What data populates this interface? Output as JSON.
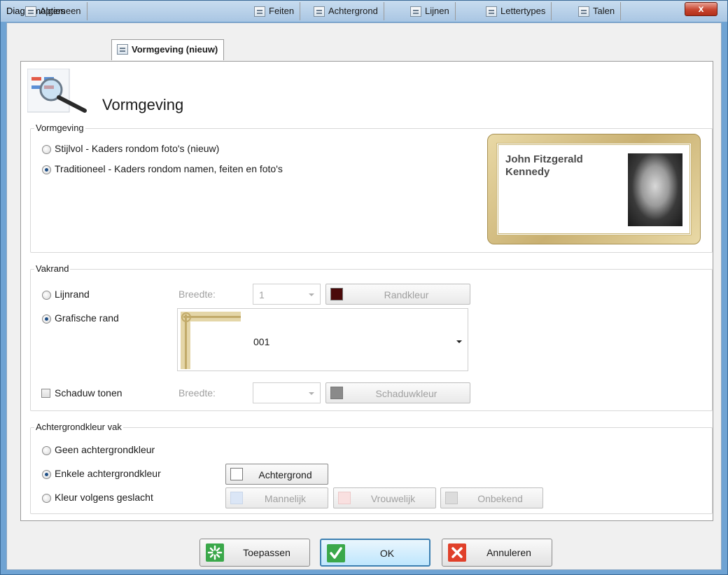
{
  "window": {
    "title": "Diagramopties",
    "close_label": "x"
  },
  "tabs": [
    {
      "label": "Algemeen",
      "icon": "settings-icon"
    },
    {
      "label": "Vormgeving (nieuw)",
      "icon": "magnifier-icon",
      "active": true
    },
    {
      "label": "Feiten",
      "icon": "facts-icon"
    },
    {
      "label": "Achtergrond",
      "icon": "background-icon"
    },
    {
      "label": "Lijnen",
      "icon": "lines-icon"
    },
    {
      "label": "Lettertypes",
      "icon": "font-icon"
    },
    {
      "label": "Talen",
      "icon": "languages-icon"
    }
  ],
  "page": {
    "heading": "Vormgeving"
  },
  "vormgeving": {
    "group_label": "Vormgeving",
    "options": [
      {
        "label": "Stijlvol - Kaders rondom foto's (nieuw)",
        "checked": false
      },
      {
        "label": "Traditioneel - Kaders rondom namen, feiten en foto's",
        "checked": true
      }
    ],
    "preview_name": "John Fitzgerald Kennedy"
  },
  "vakrand": {
    "group_label": "Vakrand",
    "lijnrand_label": "Lijnrand",
    "breedte_label": "Breedte:",
    "breedte_value": "1",
    "randkleur_label": "Randkleur",
    "randkleur_color": "#4a0a0a",
    "grafische_label": "Grafische rand",
    "frame_value": "001",
    "schaduw_label": "Schaduw tonen",
    "schaduw_breedte_label": "Breedte:",
    "schaduwkleur_label": "Schaduwkleur",
    "schaduwkleur_color": "#8a8a8a"
  },
  "achtergrond": {
    "group_label": "Achtergrondkleur vak",
    "geen_label": "Geen achtergrondkleur",
    "enkele_label": "Enkele achtergrondkleur",
    "kleur_label": "Kleur volgens geslacht",
    "achtergrond_btn": "Achtergrond",
    "mannelijk_btn": "Mannelijk",
    "vrouwelijk_btn": "Vrouwelijk",
    "onbekend_btn": "Onbekend",
    "colors": {
      "achtergrond": "#ffffff",
      "mannelijk": "#dbe6f6",
      "vrouwelijk": "#f9e0e0",
      "onbekend": "#dcdcdc"
    }
  },
  "buttons": {
    "apply": "Toepassen",
    "ok": "OK",
    "cancel": "Annuleren"
  }
}
